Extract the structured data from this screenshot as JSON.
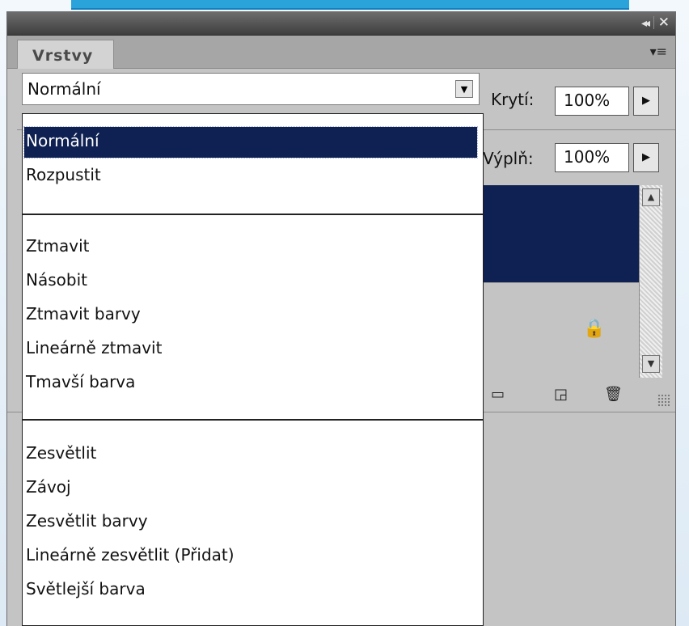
{
  "panel": {
    "tab_label": "Vrstvy",
    "collapse_glyph": "◂◂",
    "close_glyph": "✕",
    "menu_glyph": "▾≡"
  },
  "blend": {
    "selected": "Normální",
    "opacity_label": "Krytí:",
    "opacity_value": "100%",
    "fill_label": "Výplň:",
    "fill_value": "100%",
    "options_group1": [
      "Normální",
      "Rozpustit"
    ],
    "options_group2": [
      "Ztmavit",
      "Násobit",
      "Ztmavit barvy",
      "Lineárně ztmavit",
      "Tmavší barva"
    ],
    "options_group3": [
      "Zesvětlit",
      "Závoj",
      "Zesvětlit barvy",
      "Lineárně zesvětlit (Přidat)",
      "Světlejší barva"
    ]
  },
  "colors": {
    "selection": "#0f2052",
    "accent": "#2aa3da",
    "panel_bg": "#c4c4c4"
  },
  "icons": {
    "lock": "lock-icon",
    "folder": "folder-icon",
    "new_layer": "new-layer-icon",
    "trash": "trash-icon"
  }
}
